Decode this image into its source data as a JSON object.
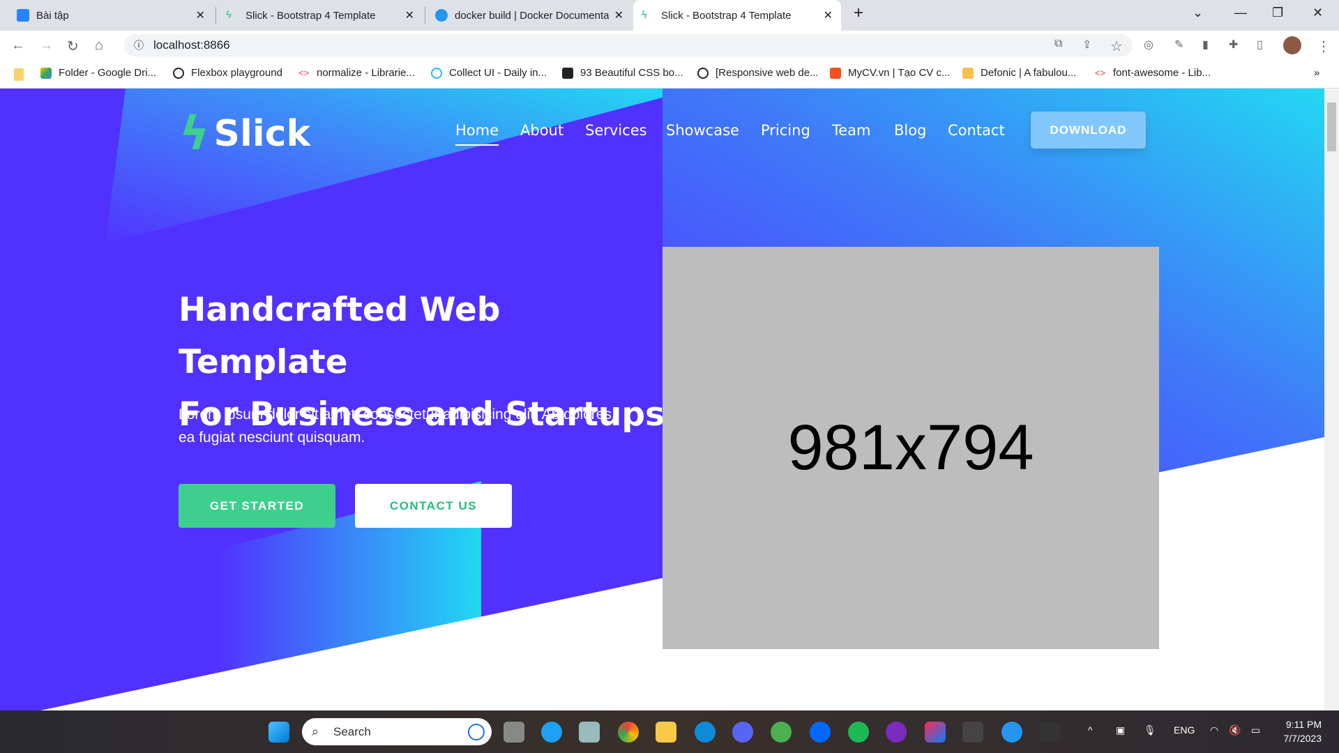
{
  "browser": {
    "tabs": [
      {
        "title": "Bài tập"
      },
      {
        "title": "Slick - Bootstrap 4 Template"
      },
      {
        "title": "docker build | Docker Documentation"
      },
      {
        "title": "Slick - Bootstrap 4 Template",
        "active": true
      }
    ],
    "url": "localhost:8866",
    "bookmarks": [
      "Folder - Google Dri...",
      "Flexbox playground",
      "normalize - Librarie...",
      "Collect UI - Daily in...",
      "93 Beautiful CSS bo...",
      "[Responsive web de...",
      "MyCV.vn | Tạo CV c...",
      "Defonic | A fabulou...",
      "font-awesome - Lib..."
    ],
    "more": "»"
  },
  "site": {
    "logo": "Slick",
    "nav": [
      "Home",
      "About",
      "Services",
      "Showcase",
      "Pricing",
      "Team",
      "Blog",
      "Contact"
    ],
    "download": "DOWNLOAD",
    "headline1": "Handcrafted Web Template",
    "headline2": "For Business and Startups",
    "lead": "Lorem ipsum dolor sit amet, consectetur adipisicing elit. Ab dolores ea fugiat nesciunt quisquam.",
    "get_started": "GET STARTED",
    "contact_us": "CONTACT US",
    "placeholder": "981x794",
    "colors": {
      "purple": "#5131ff",
      "cyan": "#22d8f2",
      "green": "#3ecf8e"
    }
  },
  "taskbar": {
    "search": "Search",
    "lang": "ENG",
    "time": "9:11 PM",
    "date": "7/7/2023"
  }
}
